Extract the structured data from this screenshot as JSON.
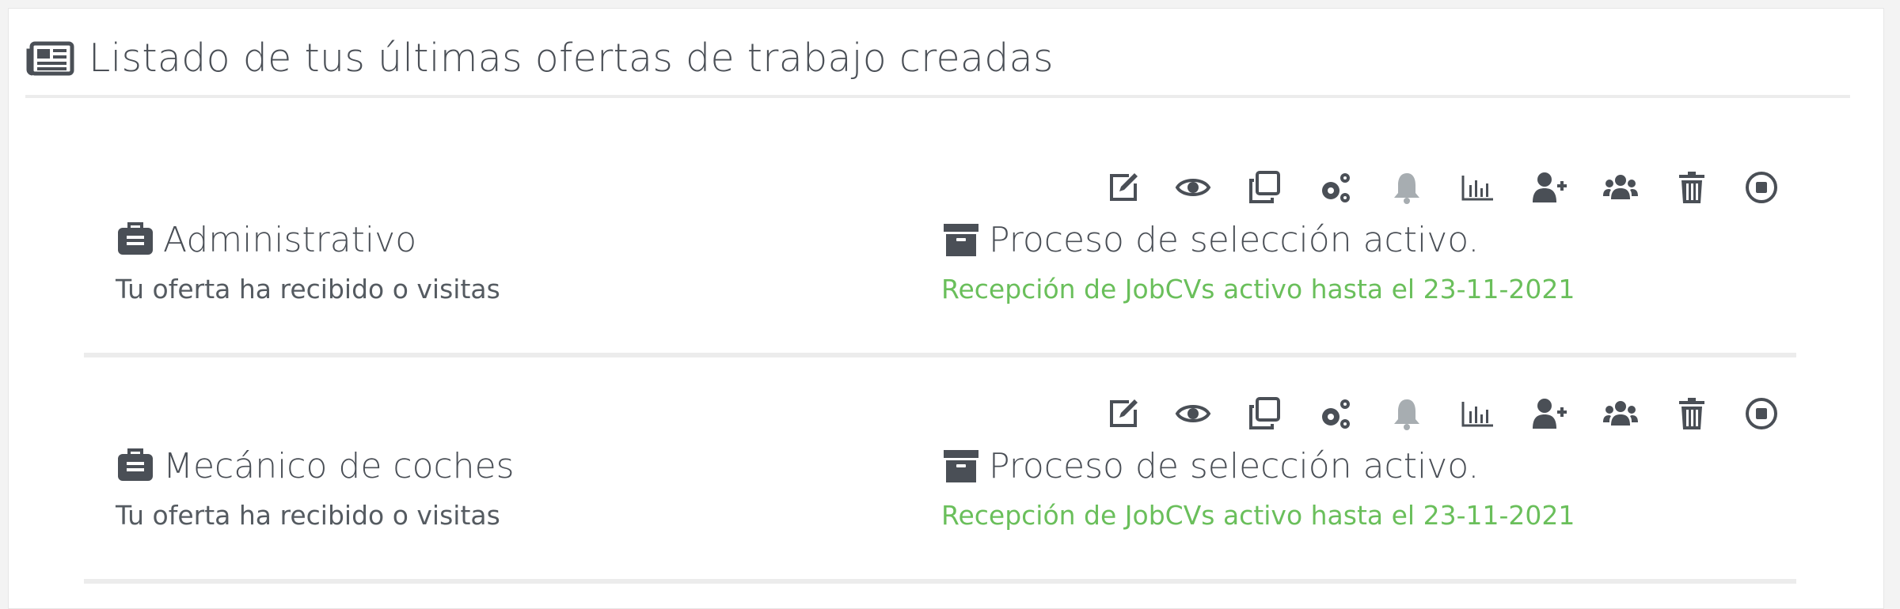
{
  "header": {
    "title": "Listado de tus últimas ofertas de trabajo creadas",
    "icon": "newspaper-icon"
  },
  "toolbar_icons": [
    "edit-icon",
    "view-icon",
    "copy-icon",
    "settings-icon",
    "bell-icon",
    "chart-icon",
    "add-user-icon",
    "users-icon",
    "trash-icon",
    "stop-icon"
  ],
  "colors": {
    "icon": "#4a4f56",
    "icon_disabled": "#a7adb1",
    "status_active": "#6abf5b",
    "divider": "#ececec"
  },
  "offers": [
    {
      "title": "Administrativo",
      "visits": "Tu oferta ha recibido o visitas",
      "status": "Proceso de selección activo.",
      "reception": "Recepción de JobCVs activo hasta el 23-11-2021"
    },
    {
      "title": "Mecánico de coches",
      "visits": "Tu oferta ha recibido o visitas",
      "status": "Proceso de selección activo.",
      "reception": "Recepción de JobCVs activo hasta el 23-11-2021"
    }
  ]
}
